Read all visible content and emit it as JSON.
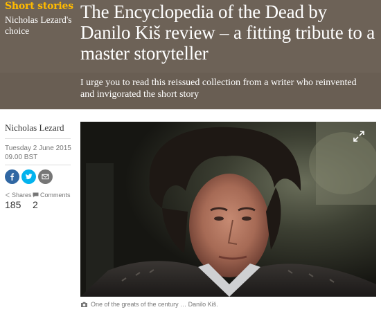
{
  "header": {
    "kicker": "Short stories",
    "series": "Nicholas Lezard's choice",
    "headline": "The Encyclopedia of the Dead by Danilo Kiš review – a fitting tribute to a master storyteller",
    "standfirst": "I urge you to read this reissued collection from a writer who reinvented and invigorated the short story"
  },
  "meta": {
    "byline": "Nicholas Lezard",
    "date": "Tuesday 2 June 2015",
    "time": "09.00 BST"
  },
  "share_buttons": [
    "facebook-icon",
    "twitter-icon",
    "email-icon"
  ],
  "stats": {
    "shares_label": "Shares",
    "shares_value": "185",
    "comments_label": "Comments",
    "comments_value": "2"
  },
  "media": {
    "caption": "One of the greats of the century … Danilo Kiš."
  },
  "colors": {
    "header_bg": "#6d6257",
    "kicker": "#ffbb00",
    "facebook": "#3067a3",
    "twitter": "#03b3ee",
    "email": "#767676"
  }
}
